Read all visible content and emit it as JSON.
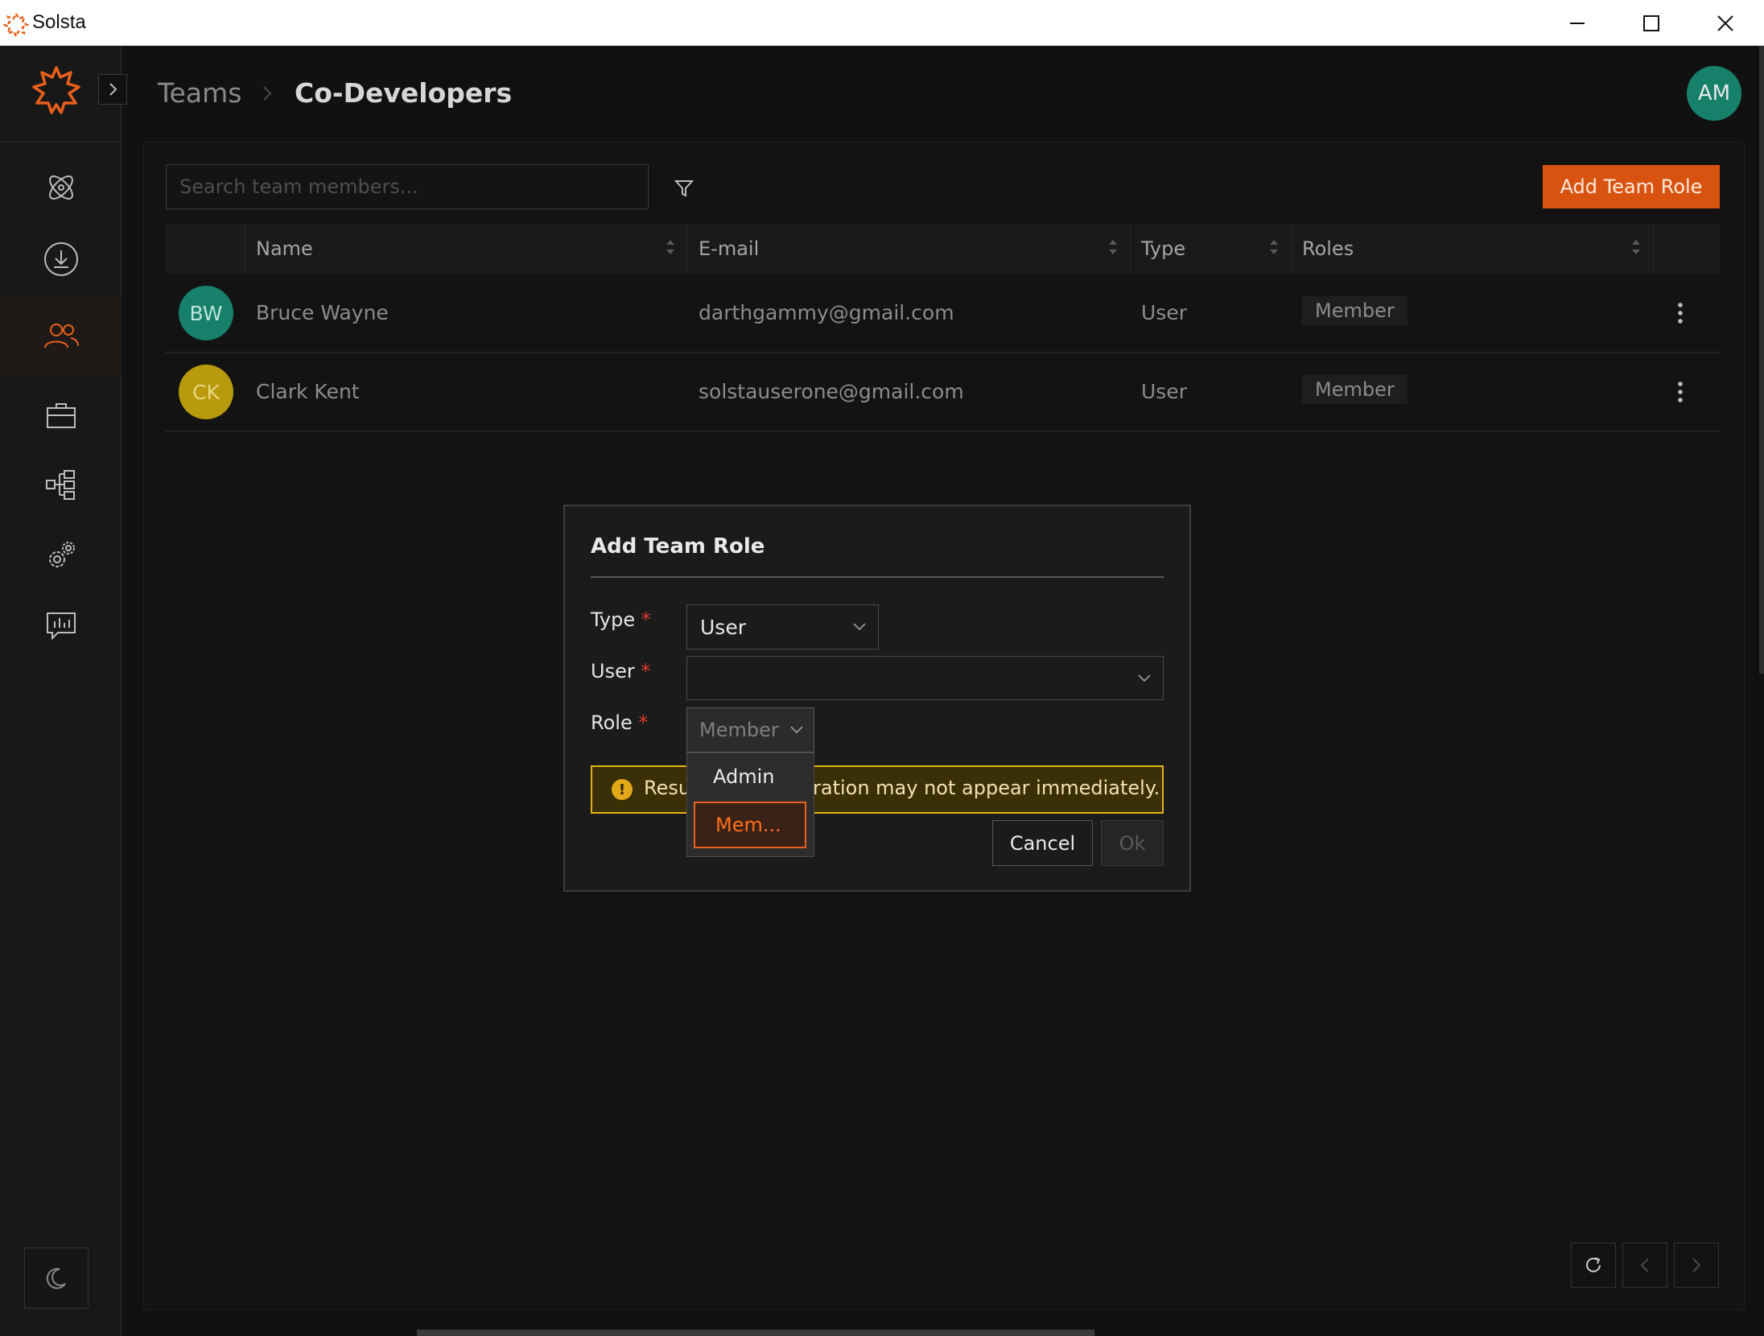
{
  "window": {
    "title": "Solsta"
  },
  "header": {
    "breadcrumb_parent": "Teams",
    "breadcrumb_current": "Co-Developers",
    "user_initials": "AM"
  },
  "toolbar": {
    "search_placeholder": "Search team members...",
    "add_button": "Add Team Role"
  },
  "table": {
    "columns": [
      "Name",
      "E-mail",
      "Type",
      "Roles"
    ],
    "rows": [
      {
        "initials": "BW",
        "name": "Bruce Wayne",
        "email": "darthgammy@gmail.com",
        "type": "User",
        "role": "Member",
        "avatar_color": "#16806a"
      },
      {
        "initials": "CK",
        "name": "Clark Kent",
        "email": "solstauserone@gmail.com",
        "type": "User",
        "role": "Member",
        "avatar_color": "#b89a0c"
      }
    ]
  },
  "modal": {
    "title": "Add Team Role",
    "type_label": "Type",
    "type_value": "User",
    "user_label": "User",
    "user_value": "",
    "role_label": "Role",
    "role_value": "Member",
    "required_mark": "*",
    "warning_visible_left": "Resu",
    "warning_visible_right": "ration may not appear immediately.",
    "cancel": "Cancel",
    "ok": "Ok",
    "role_options": [
      "Admin",
      "Mem..."
    ]
  },
  "colors": {
    "accent": "#d7530f",
    "warning_border": "#e2b318",
    "required": "#e23b2f"
  },
  "icons": [
    "solsta-logo-icon",
    "chevron-right-icon",
    "atom-icon",
    "download-icon",
    "users-icon",
    "briefcase-icon",
    "hierarchy-icon",
    "gears-icon",
    "chart-message-icon",
    "moon-icon",
    "filter-icon",
    "sort-icon",
    "kebab-icon",
    "refresh-icon",
    "chevron-left-icon",
    "minimize-icon",
    "maximize-icon",
    "close-icon",
    "warning-icon"
  ]
}
